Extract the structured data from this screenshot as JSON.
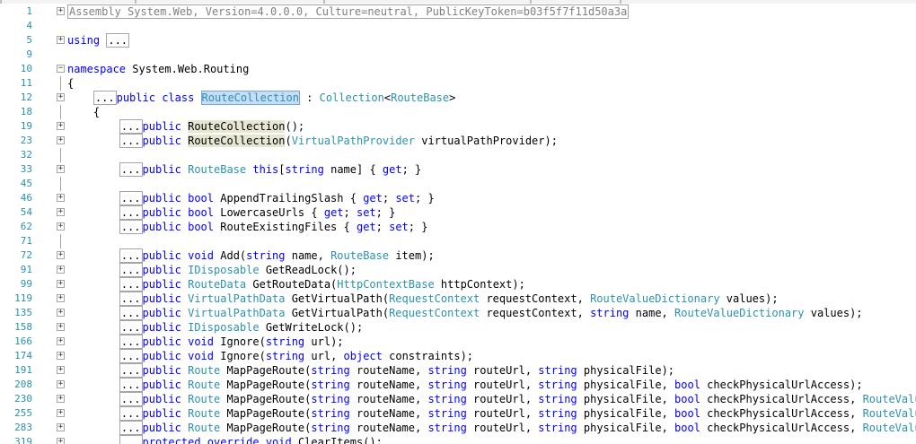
{
  "window": {
    "title": ""
  },
  "editor": {
    "lines": [
      {
        "n": "1",
        "indent": 0,
        "fold": "+",
        "parts": [
          {
            "t": "Assembly System.Web, Version=4.0.0.0, Culture=neutral, PublicKeyToken=b03f5f7f11d50a3a",
            "c": "box g"
          }
        ]
      },
      {
        "n": "4",
        "indent": 0,
        "fold": "",
        "parts": []
      },
      {
        "n": "5",
        "indent": 0,
        "fold": "+",
        "parts": [
          {
            "t": "using",
            "c": "k"
          },
          {
            "t": " ",
            "c": ""
          },
          {
            "t": "...",
            "c": "box"
          }
        ]
      },
      {
        "n": "9",
        "indent": 0,
        "fold": "",
        "parts": []
      },
      {
        "n": "10",
        "indent": 0,
        "fold": "-",
        "parts": [
          {
            "t": "namespace",
            "c": "k"
          },
          {
            "t": " System.Web.Routing",
            "c": ""
          }
        ]
      },
      {
        "n": "11",
        "indent": 0,
        "fold": "",
        "guide": true,
        "parts": [
          {
            "t": "{",
            "c": ""
          }
        ]
      },
      {
        "n": "12",
        "indent": 4,
        "fold": "+",
        "parts": [
          {
            "t": "...",
            "c": "box"
          },
          {
            "t": "public",
            "c": "k"
          },
          {
            "t": " ",
            "c": ""
          },
          {
            "t": "class",
            "c": "k"
          },
          {
            "t": " ",
            "c": ""
          },
          {
            "t": "RouteCollection",
            "c": "t sel"
          },
          {
            "t": " : ",
            "c": ""
          },
          {
            "t": "Collection",
            "c": "t"
          },
          {
            "t": "<",
            "c": ""
          },
          {
            "t": "RouteBase",
            "c": "t"
          },
          {
            "t": ">",
            "c": ""
          }
        ]
      },
      {
        "n": "18",
        "indent": 4,
        "fold": "",
        "guide": true,
        "parts": [
          {
            "t": "{",
            "c": ""
          }
        ]
      },
      {
        "n": "19",
        "indent": 8,
        "fold": "+",
        "parts": [
          {
            "t": "...",
            "c": "box"
          },
          {
            "t": "public",
            "c": "k"
          },
          {
            "t": " ",
            "c": ""
          },
          {
            "t": "RouteCollection",
            "c": "hl"
          },
          {
            "t": "();",
            "c": ""
          }
        ]
      },
      {
        "n": "23",
        "indent": 8,
        "fold": "+",
        "parts": [
          {
            "t": "...",
            "c": "box"
          },
          {
            "t": "public",
            "c": "k"
          },
          {
            "t": " ",
            "c": ""
          },
          {
            "t": "RouteCollection",
            "c": "hl"
          },
          {
            "t": "(",
            "c": ""
          },
          {
            "t": "VirtualPathProvider",
            "c": "t"
          },
          {
            "t": " virtualPathProvider);",
            "c": ""
          }
        ]
      },
      {
        "n": "32",
        "indent": 0,
        "fold": "",
        "guide": true,
        "parts": []
      },
      {
        "n": "33",
        "indent": 8,
        "fold": "+",
        "parts": [
          {
            "t": "...",
            "c": "box"
          },
          {
            "t": "public",
            "c": "k"
          },
          {
            "t": " ",
            "c": ""
          },
          {
            "t": "RouteBase",
            "c": "t"
          },
          {
            "t": " ",
            "c": ""
          },
          {
            "t": "this",
            "c": "k"
          },
          {
            "t": "[",
            "c": ""
          },
          {
            "t": "string",
            "c": "k"
          },
          {
            "t": " name] { ",
            "c": ""
          },
          {
            "t": "get",
            "c": "k"
          },
          {
            "t": "; }",
            "c": ""
          }
        ]
      },
      {
        "n": "45",
        "indent": 0,
        "fold": "",
        "guide": true,
        "parts": []
      },
      {
        "n": "46",
        "indent": 8,
        "fold": "+",
        "parts": [
          {
            "t": "...",
            "c": "box"
          },
          {
            "t": "public",
            "c": "k"
          },
          {
            "t": " ",
            "c": ""
          },
          {
            "t": "bool",
            "c": "k"
          },
          {
            "t": " AppendTrailingSlash { ",
            "c": ""
          },
          {
            "t": "get",
            "c": "k"
          },
          {
            "t": "; ",
            "c": ""
          },
          {
            "t": "set",
            "c": "k"
          },
          {
            "t": "; }",
            "c": ""
          }
        ]
      },
      {
        "n": "54",
        "indent": 8,
        "fold": "+",
        "parts": [
          {
            "t": "...",
            "c": "box"
          },
          {
            "t": "public",
            "c": "k"
          },
          {
            "t": " ",
            "c": ""
          },
          {
            "t": "bool",
            "c": "k"
          },
          {
            "t": " LowercaseUrls { ",
            "c": ""
          },
          {
            "t": "get",
            "c": "k"
          },
          {
            "t": "; ",
            "c": ""
          },
          {
            "t": "set",
            "c": "k"
          },
          {
            "t": "; }",
            "c": ""
          }
        ]
      },
      {
        "n": "62",
        "indent": 8,
        "fold": "+",
        "parts": [
          {
            "t": "...",
            "c": "box"
          },
          {
            "t": "public",
            "c": "k"
          },
          {
            "t": " ",
            "c": ""
          },
          {
            "t": "bool",
            "c": "k"
          },
          {
            "t": " RouteExistingFiles { ",
            "c": ""
          },
          {
            "t": "get",
            "c": "k"
          },
          {
            "t": "; ",
            "c": ""
          },
          {
            "t": "set",
            "c": "k"
          },
          {
            "t": "; }",
            "c": ""
          }
        ]
      },
      {
        "n": "71",
        "indent": 0,
        "fold": "",
        "guide": true,
        "parts": []
      },
      {
        "n": "72",
        "indent": 8,
        "fold": "+",
        "parts": [
          {
            "t": "...",
            "c": "box"
          },
          {
            "t": "public",
            "c": "k"
          },
          {
            "t": " ",
            "c": ""
          },
          {
            "t": "void",
            "c": "k"
          },
          {
            "t": " Add(",
            "c": ""
          },
          {
            "t": "string",
            "c": "k"
          },
          {
            "t": " name, ",
            "c": ""
          },
          {
            "t": "RouteBase",
            "c": "t"
          },
          {
            "t": " item);",
            "c": ""
          }
        ]
      },
      {
        "n": "91",
        "indent": 8,
        "fold": "+",
        "parts": [
          {
            "t": "...",
            "c": "box"
          },
          {
            "t": "public",
            "c": "k"
          },
          {
            "t": " ",
            "c": ""
          },
          {
            "t": "IDisposable",
            "c": "t"
          },
          {
            "t": " GetReadLock();",
            "c": ""
          }
        ]
      },
      {
        "n": "99",
        "indent": 8,
        "fold": "+",
        "parts": [
          {
            "t": "...",
            "c": "box"
          },
          {
            "t": "public",
            "c": "k"
          },
          {
            "t": " ",
            "c": ""
          },
          {
            "t": "RouteData",
            "c": "t"
          },
          {
            "t": " GetRouteData(",
            "c": ""
          },
          {
            "t": "HttpContextBase",
            "c": "t"
          },
          {
            "t": " httpContext);",
            "c": ""
          }
        ]
      },
      {
        "n": "119",
        "indent": 8,
        "fold": "+",
        "parts": [
          {
            "t": "...",
            "c": "box"
          },
          {
            "t": "public",
            "c": "k"
          },
          {
            "t": " ",
            "c": ""
          },
          {
            "t": "VirtualPathData",
            "c": "t"
          },
          {
            "t": " GetVirtualPath(",
            "c": ""
          },
          {
            "t": "RequestContext",
            "c": "t"
          },
          {
            "t": " requestContext, ",
            "c": ""
          },
          {
            "t": "RouteValueDictionary",
            "c": "t"
          },
          {
            "t": " values);",
            "c": ""
          }
        ]
      },
      {
        "n": "135",
        "indent": 8,
        "fold": "+",
        "parts": [
          {
            "t": "...",
            "c": "box"
          },
          {
            "t": "public",
            "c": "k"
          },
          {
            "t": " ",
            "c": ""
          },
          {
            "t": "VirtualPathData",
            "c": "t"
          },
          {
            "t": " GetVirtualPath(",
            "c": ""
          },
          {
            "t": "RequestContext",
            "c": "t"
          },
          {
            "t": " requestContext, ",
            "c": ""
          },
          {
            "t": "string",
            "c": "k"
          },
          {
            "t": " name, ",
            "c": ""
          },
          {
            "t": "RouteValueDictionary",
            "c": "t"
          },
          {
            "t": " values);",
            "c": ""
          }
        ]
      },
      {
        "n": "158",
        "indent": 8,
        "fold": "+",
        "parts": [
          {
            "t": "...",
            "c": "box"
          },
          {
            "t": "public",
            "c": "k"
          },
          {
            "t": " ",
            "c": ""
          },
          {
            "t": "IDisposable",
            "c": "t"
          },
          {
            "t": " GetWriteLock();",
            "c": ""
          }
        ]
      },
      {
        "n": "166",
        "indent": 8,
        "fold": "+",
        "parts": [
          {
            "t": "...",
            "c": "box"
          },
          {
            "t": "public",
            "c": "k"
          },
          {
            "t": " ",
            "c": ""
          },
          {
            "t": "void",
            "c": "k"
          },
          {
            "t": " Ignore(",
            "c": ""
          },
          {
            "t": "string",
            "c": "k"
          },
          {
            "t": " url);",
            "c": ""
          }
        ]
      },
      {
        "n": "174",
        "indent": 8,
        "fold": "+",
        "parts": [
          {
            "t": "...",
            "c": "box"
          },
          {
            "t": "public",
            "c": "k"
          },
          {
            "t": " ",
            "c": ""
          },
          {
            "t": "void",
            "c": "k"
          },
          {
            "t": " Ignore(",
            "c": ""
          },
          {
            "t": "string",
            "c": "k"
          },
          {
            "t": " url, ",
            "c": ""
          },
          {
            "t": "object",
            "c": "k"
          },
          {
            "t": " constraints);",
            "c": ""
          }
        ]
      },
      {
        "n": "191",
        "indent": 8,
        "fold": "+",
        "parts": [
          {
            "t": "...",
            "c": "box"
          },
          {
            "t": "public",
            "c": "k"
          },
          {
            "t": " ",
            "c": ""
          },
          {
            "t": "Route",
            "c": "t"
          },
          {
            "t": " MapPageRoute(",
            "c": ""
          },
          {
            "t": "string",
            "c": "k"
          },
          {
            "t": " routeName, ",
            "c": ""
          },
          {
            "t": "string",
            "c": "k"
          },
          {
            "t": " routeUrl, ",
            "c": ""
          },
          {
            "t": "string",
            "c": "k"
          },
          {
            "t": " physicalFile);",
            "c": ""
          }
        ]
      },
      {
        "n": "208",
        "indent": 8,
        "fold": "+",
        "parts": [
          {
            "t": "...",
            "c": "box"
          },
          {
            "t": "public",
            "c": "k"
          },
          {
            "t": " ",
            "c": ""
          },
          {
            "t": "Route",
            "c": "t"
          },
          {
            "t": " MapPageRoute(",
            "c": ""
          },
          {
            "t": "string",
            "c": "k"
          },
          {
            "t": " routeName, ",
            "c": ""
          },
          {
            "t": "string",
            "c": "k"
          },
          {
            "t": " routeUrl, ",
            "c": ""
          },
          {
            "t": "string",
            "c": "k"
          },
          {
            "t": " physicalFile, ",
            "c": ""
          },
          {
            "t": "bool",
            "c": "k"
          },
          {
            "t": " checkPhysicalUrlAccess);",
            "c": ""
          }
        ]
      },
      {
        "n": "230",
        "indent": 8,
        "fold": "+",
        "parts": [
          {
            "t": "...",
            "c": "box"
          },
          {
            "t": "public",
            "c": "k"
          },
          {
            "t": " ",
            "c": ""
          },
          {
            "t": "Route",
            "c": "t"
          },
          {
            "t": " MapPageRoute(",
            "c": ""
          },
          {
            "t": "string",
            "c": "k"
          },
          {
            "t": " routeName, ",
            "c": ""
          },
          {
            "t": "string",
            "c": "k"
          },
          {
            "t": " routeUrl, ",
            "c": ""
          },
          {
            "t": "string",
            "c": "k"
          },
          {
            "t": " physicalFile, ",
            "c": ""
          },
          {
            "t": "bool",
            "c": "k"
          },
          {
            "t": " checkPhysicalUrlAccess, ",
            "c": ""
          },
          {
            "t": "RouteValueDic",
            "c": "t"
          }
        ]
      },
      {
        "n": "255",
        "indent": 8,
        "fold": "+",
        "parts": [
          {
            "t": "...",
            "c": "box"
          },
          {
            "t": "public",
            "c": "k"
          },
          {
            "t": " ",
            "c": ""
          },
          {
            "t": "Route",
            "c": "t"
          },
          {
            "t": " MapPageRoute(",
            "c": ""
          },
          {
            "t": "string",
            "c": "k"
          },
          {
            "t": " routeName, ",
            "c": ""
          },
          {
            "t": "string",
            "c": "k"
          },
          {
            "t": " routeUrl, ",
            "c": ""
          },
          {
            "t": "string",
            "c": "k"
          },
          {
            "t": " physicalFile, ",
            "c": ""
          },
          {
            "t": "bool",
            "c": "k"
          },
          {
            "t": " checkPhysicalUrlAccess, ",
            "c": ""
          },
          {
            "t": "RouteValueDic",
            "c": "t"
          }
        ]
      },
      {
        "n": "283",
        "indent": 8,
        "fold": "+",
        "parts": [
          {
            "t": "...",
            "c": "box"
          },
          {
            "t": "public",
            "c": "k"
          },
          {
            "t": " ",
            "c": ""
          },
          {
            "t": "Route",
            "c": "t"
          },
          {
            "t": " MapPageRoute(",
            "c": ""
          },
          {
            "t": "string",
            "c": "k"
          },
          {
            "t": " routeName, ",
            "c": ""
          },
          {
            "t": "string",
            "c": "k"
          },
          {
            "t": " routeUrl, ",
            "c": ""
          },
          {
            "t": "string",
            "c": "k"
          },
          {
            "t": " physicalFile, ",
            "c": ""
          },
          {
            "t": "bool",
            "c": "k"
          },
          {
            "t": " checkPhysicalUrlAccess, ",
            "c": ""
          },
          {
            "t": "RouteValueDic",
            "c": "t"
          }
        ]
      },
      {
        "n": "319",
        "indent": 8,
        "fold": "+",
        "parts": [
          {
            "t": "...",
            "c": "box"
          },
          {
            "t": "protected",
            "c": "k"
          },
          {
            "t": " ",
            "c": ""
          },
          {
            "t": "override",
            "c": "k"
          },
          {
            "t": " ",
            "c": ""
          },
          {
            "t": "void",
            "c": "k"
          },
          {
            "t": " ClearItems();",
            "c": ""
          }
        ]
      }
    ]
  }
}
